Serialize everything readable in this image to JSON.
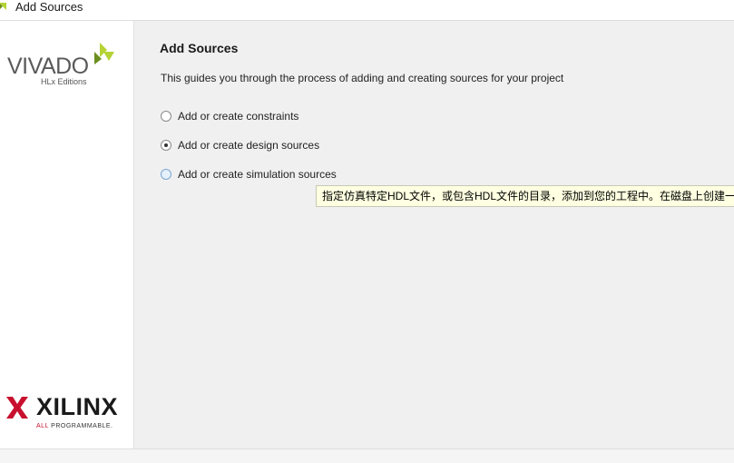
{
  "window": {
    "title": "Add Sources"
  },
  "sidebar": {
    "vivado": {
      "name": "VIVADO",
      "edition": "HLx Editions"
    },
    "xilinx": {
      "name": "XILINX",
      "tagline_accent": "ALL",
      "tagline": "PROGRAMMABLE."
    }
  },
  "main": {
    "heading": "Add Sources",
    "description": "This guides you through the process of adding and creating sources for your project",
    "options": [
      {
        "label": "Add or create constraints",
        "checked": false
      },
      {
        "label": "Add or create design sources",
        "checked": true
      },
      {
        "label": "Add or create simulation sources",
        "checked": false
      }
    ],
    "tooltip": "指定仿真特定HDL文件，或包含HDL文件的目录，添加到您的工程中。在磁盘上创建一"
  },
  "colors": {
    "vivado_leaf_light": "#b5d334",
    "vivado_leaf_dark": "#6c8f20",
    "xilinx_red": "#c8102e"
  }
}
